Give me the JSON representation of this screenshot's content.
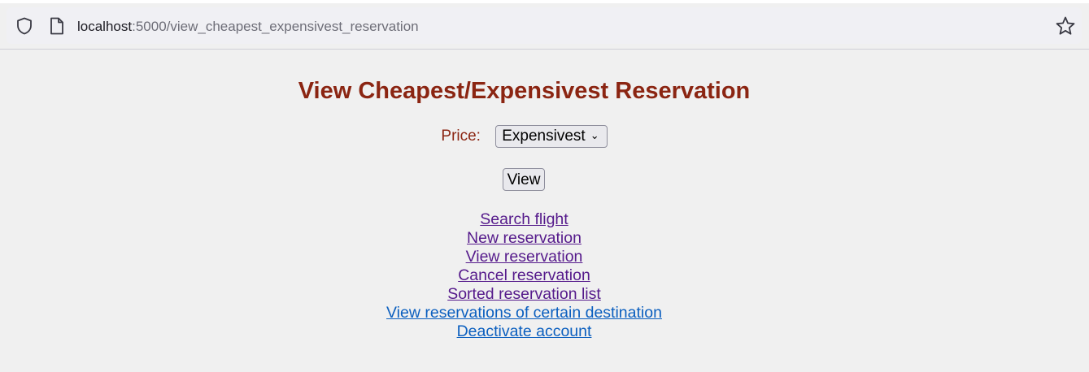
{
  "browser": {
    "url_host": "localhost",
    "url_path": ":5000/view_cheapest_expensivest_reservation",
    "icons": [
      "shield-icon",
      "page-icon",
      "bookmark-star-icon"
    ]
  },
  "page": {
    "title": "View Cheapest/Expensivest Reservation",
    "price_label": "Price:",
    "price_selected": "Expensivest",
    "view_button": "View"
  },
  "links": [
    {
      "label": "Search flight",
      "visited": true
    },
    {
      "label": "New reservation",
      "visited": true
    },
    {
      "label": "View reservation",
      "visited": true
    },
    {
      "label": "Cancel reservation",
      "visited": true
    },
    {
      "label": "Sorted reservation list",
      "visited": true
    },
    {
      "label": "View reservations of certain destination",
      "visited": false
    },
    {
      "label": "Deactivate account",
      "visited": false
    }
  ],
  "colors": {
    "heading": "#8b2512",
    "visited_link": "#551a8b",
    "unvisited_link": "#0b5fbf"
  }
}
